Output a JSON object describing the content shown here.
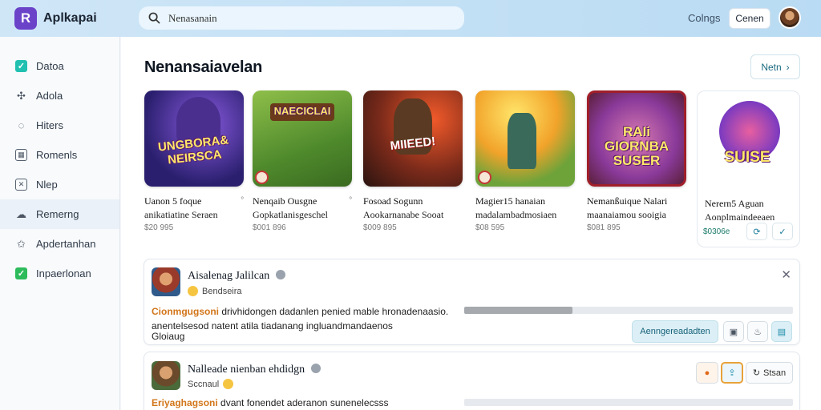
{
  "app": {
    "name": "Aplkapai",
    "logo_letter": "R"
  },
  "search": {
    "placeholder": "Nenasanain"
  },
  "header": {
    "link": "Colngs",
    "button": "Cenen"
  },
  "sidebar": {
    "items": [
      {
        "label": "Datoa",
        "icon": "checkbox-icon"
      },
      {
        "label": "Adola",
        "icon": "puzzle-icon"
      },
      {
        "label": "Hiters",
        "icon": "chat-icon"
      },
      {
        "label": "Romenls",
        "icon": "grid-icon"
      },
      {
        "label": "Nlep",
        "icon": "mail-icon"
      },
      {
        "label": "Remerng",
        "icon": "cloud-icon"
      },
      {
        "label": "Apdertanhan",
        "icon": "star-icon"
      },
      {
        "label": "Inpaerlonan",
        "icon": "checkbox-green-icon"
      }
    ]
  },
  "featured": {
    "title": "Nenansaiavelan",
    "more_label": "Netn",
    "cards": [
      {
        "art": "UNGBORA& NEIRSCA",
        "title": "Uanon 5 foque",
        "sub": "anikatiatine Seraen",
        "price": "$20 995"
      },
      {
        "art": "NAECICLAI",
        "title": "Nenqaib Ousgne",
        "sub": "Gopkatlanisgeschel",
        "price": "$001 896"
      },
      {
        "art": "MIIEED!",
        "title": "Fosoad Sogunn",
        "sub": "Aookarnanabe Sooat",
        "price": "$009 895"
      },
      {
        "art": "",
        "title": "Magier15 hanaian",
        "sub": "madalambadmosiaen",
        "price": "$08 595"
      },
      {
        "art": "RAIi GIORNBA SUSER",
        "title": "Nemanßuique Nalari",
        "sub": "maanaiamou sooigia",
        "price": "$081 895"
      },
      {
        "art": "SUISE",
        "title": "Nerern5 Aguan",
        "sub": "Aonplmaindeeaen",
        "price": "$0306e"
      }
    ]
  },
  "panels": [
    {
      "title": "Aisalenag Jalilcan",
      "sub": "Bendseira",
      "highlight": "Cionmgugsoni",
      "line1": "drivhidongen dadanlen penied mable hronadenaasio.",
      "line2": "anentelsesod natent atila tiadanang ingluandmandaenos",
      "line3": "Gloiaug",
      "progress": 0.33,
      "action": "Aenngereadadten"
    },
    {
      "title": "Nalleade nienban ehdidgn",
      "sub": "Sccnaul",
      "highlight": "Eriyaghagsoni",
      "line1": "dvant fonendet aderanon sunenelecsss",
      "action": "Stsan"
    }
  ]
}
